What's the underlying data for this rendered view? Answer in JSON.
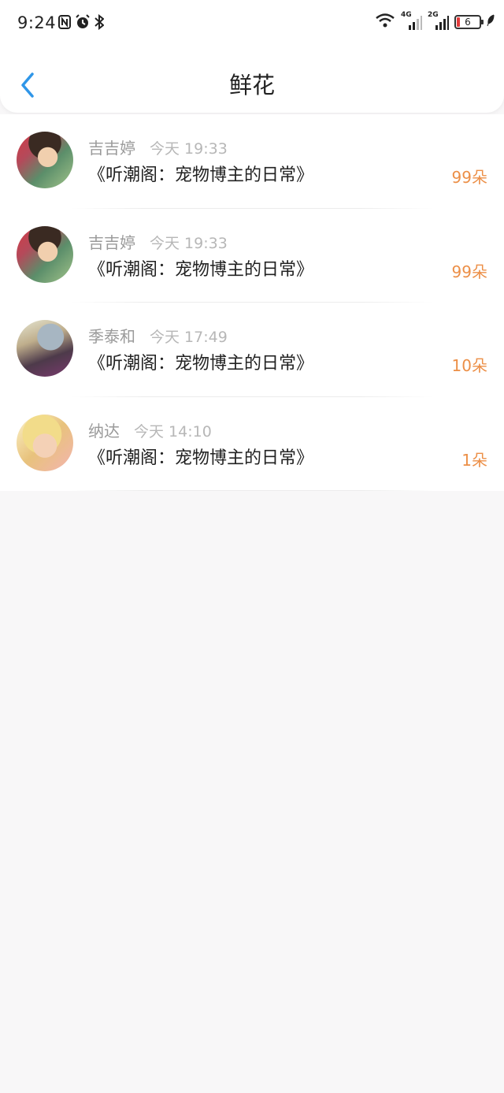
{
  "status_bar": {
    "time": "9:24",
    "left_icons": [
      "nfc-icon",
      "alarm-icon",
      "bluetooth-icon"
    ],
    "net1_label": "4G",
    "net2_label": "2G",
    "battery_level": "6",
    "colors": {
      "battery_low": "#e23b3b"
    }
  },
  "header": {
    "title": "鲜花",
    "back_icon": "chevron-left-icon",
    "back_color": "#2f96e8"
  },
  "items": [
    {
      "name": "吉吉婷",
      "time": "今天 19:33",
      "work": "《听潮阁：宠物博主的日常》",
      "count": "99朵"
    },
    {
      "name": "吉吉婷",
      "time": "今天 19:33",
      "work": "《听潮阁：宠物博主的日常》",
      "count": "99朵"
    },
    {
      "name": "季泰和",
      "time": "今天 17:49",
      "work": "《听潮阁：宠物博主的日常》",
      "count": "10朵"
    },
    {
      "name": "纳达",
      "time": "今天 14:10",
      "work": "《听潮阁：宠物博主的日常》",
      "count": "1朵"
    }
  ],
  "colors": {
    "count": "#ec8f47",
    "background": "#f8f7f8"
  }
}
